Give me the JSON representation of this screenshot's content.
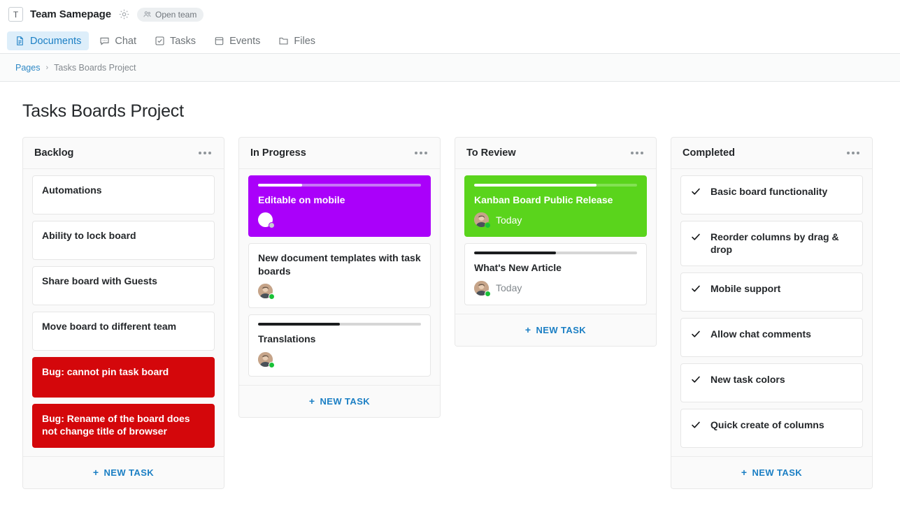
{
  "topbar": {
    "team_initial": "T",
    "team_name": "Team Samepage",
    "gear_icon": "gear-icon",
    "open_team_label": "Open team",
    "people_icon": "people-icon"
  },
  "tabs": [
    {
      "label": "Documents",
      "icon": "document-icon",
      "active": true
    },
    {
      "label": "Chat",
      "icon": "chat-bubble-icon",
      "active": false
    },
    {
      "label": "Tasks",
      "icon": "checkbox-icon",
      "active": false
    },
    {
      "label": "Events",
      "icon": "calendar-icon",
      "active": false
    },
    {
      "label": "Files",
      "icon": "folder-icon",
      "active": false
    }
  ],
  "breadcrumb": {
    "root": "Pages",
    "separator": "›",
    "current": "Tasks Boards Project"
  },
  "page": {
    "title": "Tasks Boards Project"
  },
  "colors": {
    "accent_blue": "#1b7fc4",
    "card_magenta": "#aa00fa",
    "card_green": "#5ad41c",
    "card_red": "#d4070b",
    "online_green": "#19c137",
    "away_gray": "#c8cdd1"
  },
  "new_task_label": "NEW TASK",
  "new_task_plus": "+",
  "columns": [
    {
      "title": "Backlog",
      "menu_icon": "ellipsis-icon",
      "cards": [
        {
          "title": "Automations",
          "color": "white"
        },
        {
          "title": "Ability to lock board",
          "color": "white"
        },
        {
          "title": "Share board with Guests",
          "color": "white"
        },
        {
          "title": "Move board to different team",
          "color": "white"
        },
        {
          "title": "Bug: cannot pin task board",
          "color": "red"
        },
        {
          "title": "Bug: Rename of the board does not change title of browser",
          "color": "red"
        }
      ]
    },
    {
      "title": "In Progress",
      "menu_icon": "ellipsis-icon",
      "cards": [
        {
          "title": "Editable on mobile",
          "color": "magenta",
          "progress": 27,
          "avatar": "blank-avatar",
          "status": "away"
        },
        {
          "title": "New document templates with task boards",
          "color": "white",
          "avatar": "user-photo-avatar",
          "status": "online"
        },
        {
          "title": "Translations",
          "color": "white",
          "progress": 50,
          "avatar": "user-photo-avatar",
          "status": "online"
        }
      ]
    },
    {
      "title": "To Review",
      "menu_icon": "ellipsis-icon",
      "cards": [
        {
          "title": "Kanban Board Public Release",
          "color": "green",
          "progress": 75,
          "avatar": "user-photo-avatar",
          "status": "online",
          "due": "Today"
        },
        {
          "title": "What's New Article",
          "color": "white",
          "progress": 50,
          "avatar": "user-photo-avatar",
          "status": "online",
          "due": "Today"
        }
      ]
    },
    {
      "title": "Completed",
      "menu_icon": "ellipsis-icon",
      "cards": [
        {
          "title": "Basic board functionality",
          "color": "white",
          "done": true
        },
        {
          "title": "Reorder columns by drag & drop",
          "color": "white",
          "done": true
        },
        {
          "title": "Mobile support",
          "color": "white",
          "done": true
        },
        {
          "title": "Allow chat comments",
          "color": "white",
          "done": true
        },
        {
          "title": "New task colors",
          "color": "white",
          "done": true
        },
        {
          "title": "Quick create of columns",
          "color": "white",
          "done": true
        }
      ]
    }
  ]
}
